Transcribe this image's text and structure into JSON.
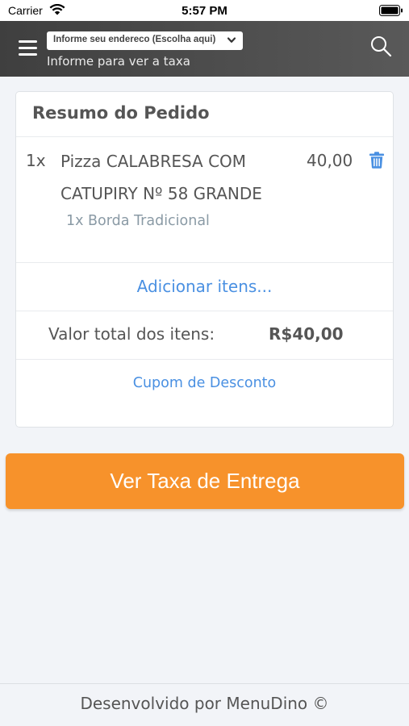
{
  "status_bar": {
    "carrier": "Carrier",
    "time": "5:57 PM"
  },
  "header": {
    "address_select": "Informe seu endereco (Escolha aqui)",
    "address_hint": "Informe para ver a taxa",
    "icons": [
      "menu-icon",
      "chevron-down-icon",
      "search-icon"
    ]
  },
  "order_summary": {
    "title": "Resumo do Pedido",
    "items": [
      {
        "qty": "1x",
        "name": "Pizza CALABRESA COM CATUPIRY Nº 58 GRANDE",
        "price": "40,00",
        "option": "1x Borda Tradicional"
      }
    ],
    "add_items_label": "Adicionar itens...",
    "total_label": "Valor total dos itens:",
    "total_value": "R$40,00",
    "coupon_label": "Cupom de Desconto"
  },
  "primary_button": {
    "label": "Ver Taxa de Entrega"
  },
  "footer": {
    "text": "Desenvolvido por MenuDino ©"
  },
  "colors": {
    "accent_orange": "#f7922b",
    "link_blue": "#4a90e2",
    "header_gray": "#4a4a4a"
  }
}
